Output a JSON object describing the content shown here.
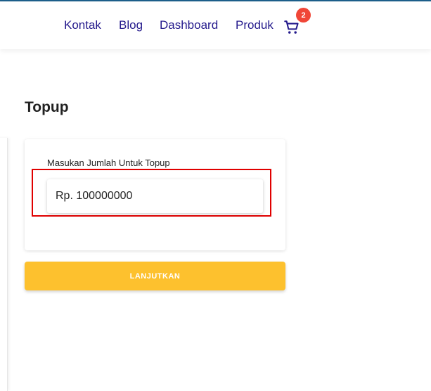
{
  "nav": {
    "links": [
      {
        "label": "Kontak"
      },
      {
        "label": "Blog"
      },
      {
        "label": "Dashboard"
      },
      {
        "label": "Produk"
      }
    ],
    "cart_count": "2"
  },
  "page": {
    "title": "Topup"
  },
  "form": {
    "label": "Masukan Jumlah Untuk Topup",
    "amount_value": "Rp. 100000000"
  },
  "actions": {
    "continue_label": "LANJUTKAN"
  },
  "colors": {
    "nav_link": "#241a8c",
    "badge": "#f04637",
    "button": "#fdc12e",
    "highlight_border": "#e00000"
  },
  "icons": {
    "cart": "shopping-cart-icon"
  }
}
